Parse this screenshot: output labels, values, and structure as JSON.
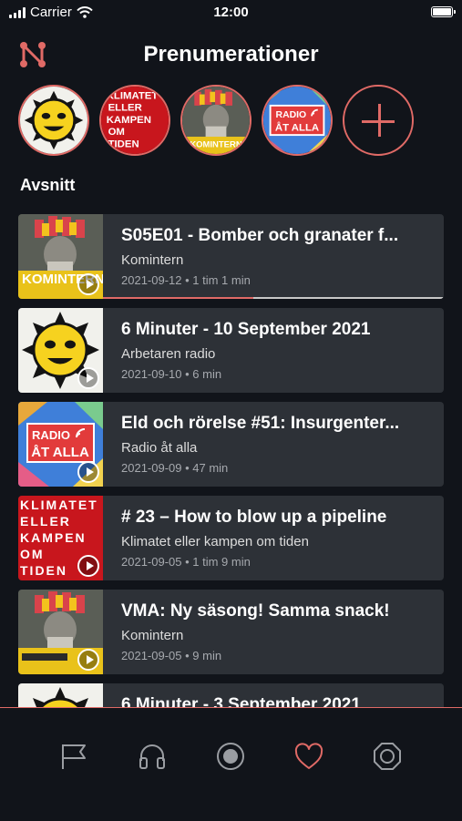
{
  "status_bar": {
    "carrier": "Carrier",
    "time": "12:00"
  },
  "header": {
    "title": "Prenumerationer",
    "logo_icon": "n-logo-icon"
  },
  "subscriptions": [
    {
      "name": "Arbetaren radio",
      "icon": "sun-face-art"
    },
    {
      "name": "Klimatet eller kampen om tiden",
      "icon": "klimatet-text-art"
    },
    {
      "name": "Komintern",
      "icon": "komintern-art"
    },
    {
      "name": "Radio åt alla",
      "icon": "radio-at-alla-art"
    }
  ],
  "add_subscription_icon": "plus-icon",
  "section": {
    "title": "Avsnitt"
  },
  "episodes": [
    {
      "title": "S05E01 - Bomber och granater f...",
      "show": "Komintern",
      "meta": "2021-09-12 • 1 tim 1 min",
      "progress": 0.44
    },
    {
      "title": "6 Minuter - 10 September 2021",
      "show": "Arbetaren radio",
      "meta": "2021-09-10 • 6 min"
    },
    {
      "title": "Eld och rörelse #51: Insurgenter...",
      "show": "Radio åt alla",
      "meta": "2021-09-09 • 47 min"
    },
    {
      "title": "# 23 – How to blow up a pipeline",
      "show": "Klimatet eller kampen om tiden",
      "meta": "2021-09-05 • 1 tim 9 min"
    },
    {
      "title": "VMA: Ny säsong! Samma snack!",
      "show": "Komintern",
      "meta": "2021-09-05 • 9 min"
    },
    {
      "title": "6 Minuter - 3 September 2021",
      "show": "",
      "meta": ""
    }
  ],
  "art_text": {
    "klimatet": [
      "KLIMATET",
      "ELLER",
      "KAMPEN",
      "OM",
      "TIDEN"
    ],
    "radio": [
      "RADIO",
      "ÅT ALLA"
    ],
    "komintern": "KOMINTERN"
  },
  "tabs": [
    {
      "name": "flag-icon",
      "active": false
    },
    {
      "name": "headphones-icon",
      "active": false
    },
    {
      "name": "record-icon",
      "active": false
    },
    {
      "name": "heart-icon",
      "active": true
    },
    {
      "name": "settings-icon",
      "active": false
    }
  ],
  "colors": {
    "accent": "#e06a66",
    "background": "#11141a",
    "card": "#2d3137",
    "tab_inactive": "#9a9da2"
  }
}
